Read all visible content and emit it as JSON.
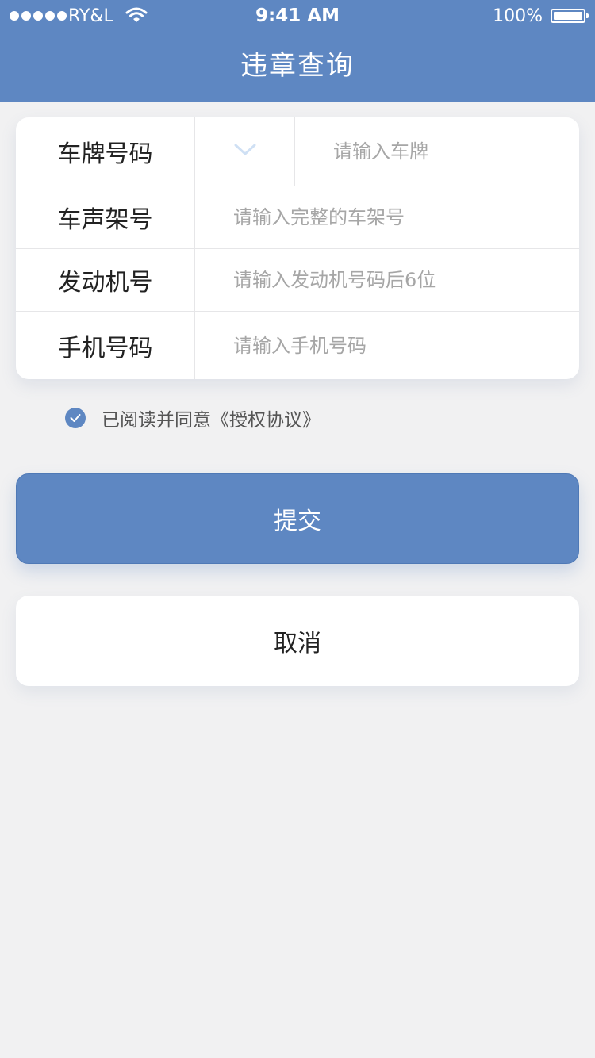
{
  "status_bar": {
    "carrier": "RY&L",
    "time": "9:41 AM",
    "battery": "100%",
    "battery_level": 100
  },
  "header": {
    "title": "违章查询"
  },
  "form": {
    "plate": {
      "label": "车牌号码",
      "placeholder": "请输入车牌"
    },
    "vin": {
      "label": "车声架号",
      "placeholder": "请输入完整的车架号"
    },
    "engine": {
      "label": "发动机号",
      "placeholder": "请输入发动机号码后6位"
    },
    "phone": {
      "label": "手机号码",
      "placeholder": "请输入手机号码"
    }
  },
  "agreement": {
    "checked": true,
    "text": "已阅读并同意《授权协议》"
  },
  "buttons": {
    "submit": "提交",
    "cancel": "取消"
  },
  "colors": {
    "primary": "#5e87c2",
    "background": "#f1f1f2",
    "card": "#ffffff",
    "placeholder": "#a6a6a6"
  },
  "icons": {
    "signal": "signal-dots-icon",
    "wifi": "wifi-icon",
    "battery": "battery-icon",
    "dropdown": "chevron-down-icon",
    "checkbox": "check-icon"
  }
}
